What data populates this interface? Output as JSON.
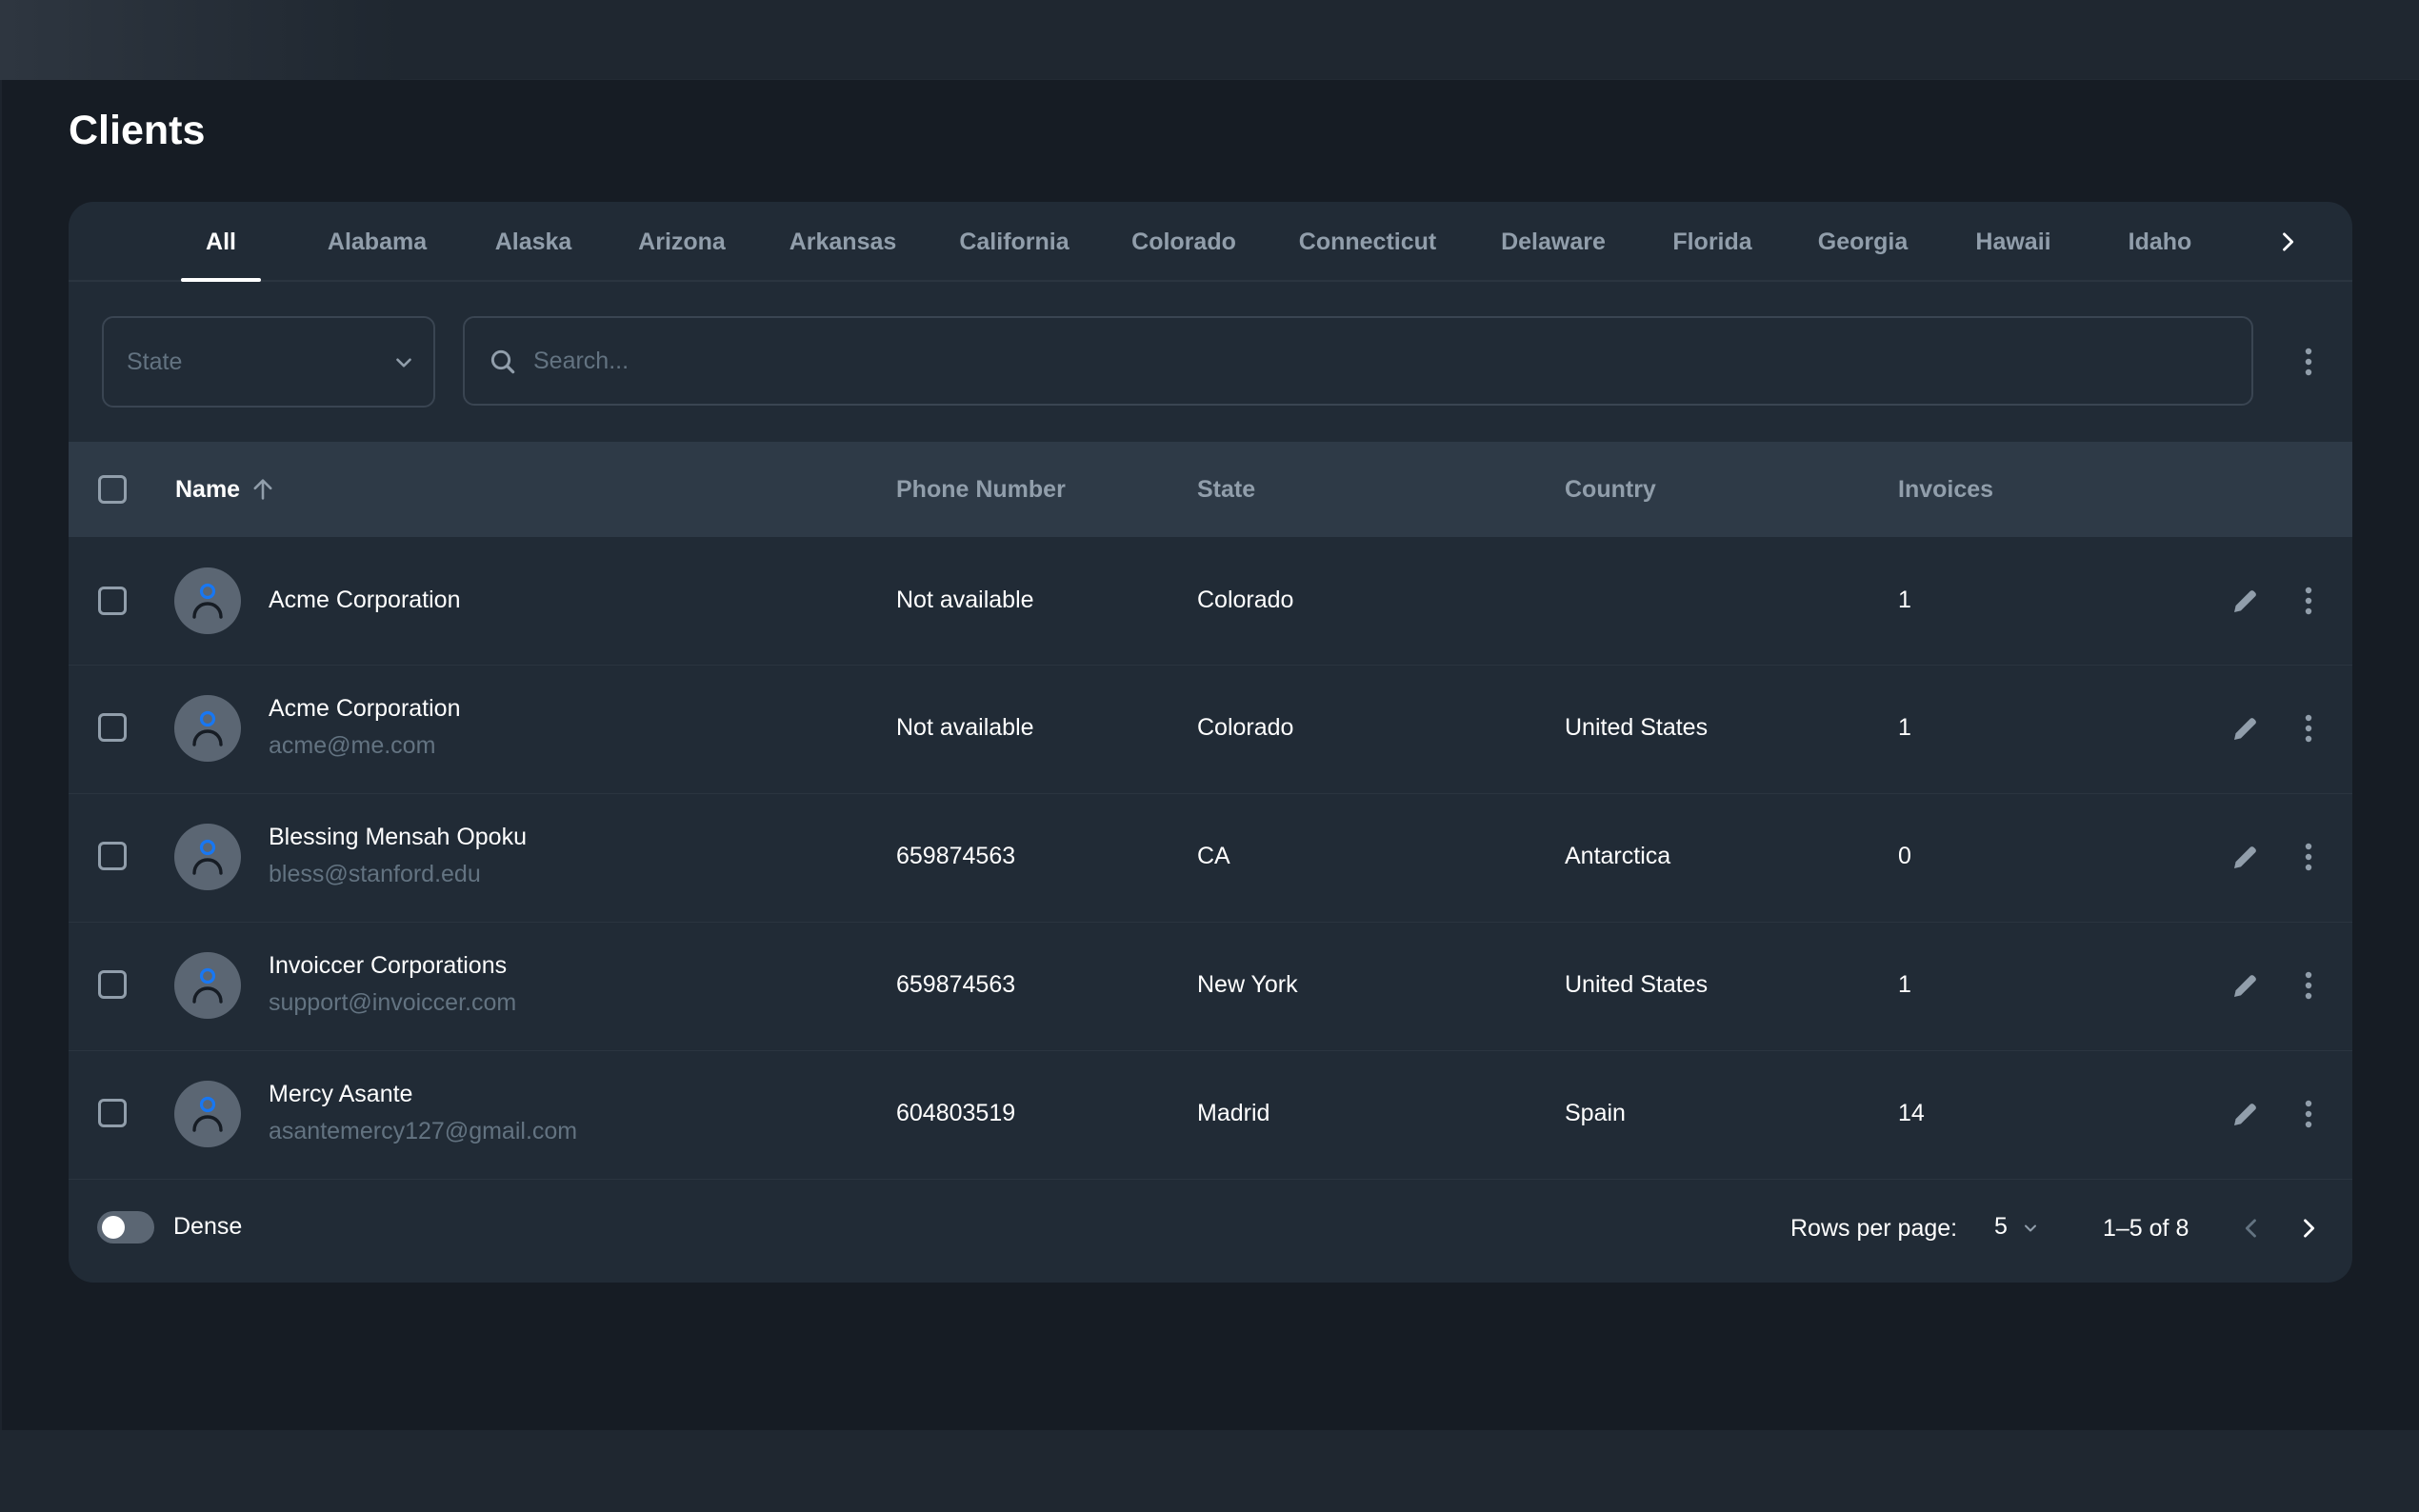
{
  "page": {
    "title": "Clients"
  },
  "tabs": [
    {
      "label": "All",
      "active": true
    },
    {
      "label": "Alabama"
    },
    {
      "label": "Alaska"
    },
    {
      "label": "Arizona"
    },
    {
      "label": "Arkansas"
    },
    {
      "label": "California"
    },
    {
      "label": "Colorado"
    },
    {
      "label": "Connecticut"
    },
    {
      "label": "Delaware"
    },
    {
      "label": "Florida"
    },
    {
      "label": "Georgia"
    },
    {
      "label": "Hawaii"
    },
    {
      "label": "Idaho"
    }
  ],
  "filters": {
    "state_placeholder": "State",
    "search_placeholder": "Search..."
  },
  "table": {
    "headers": {
      "name": "Name",
      "phone": "Phone Number",
      "state": "State",
      "country": "Country",
      "invoices": "Invoices"
    },
    "sort": {
      "column": "name",
      "direction": "ascending"
    },
    "rows": [
      {
        "name": "Acme Corporation",
        "email": "",
        "phone": "Not available",
        "state": "Colorado",
        "country": "",
        "invoices": "1"
      },
      {
        "name": "Acme Corporation",
        "email": "acme@me.com",
        "phone": "Not available",
        "state": "Colorado",
        "country": "United States",
        "invoices": "1"
      },
      {
        "name": "Blessing Mensah Opoku",
        "email": "bless@stanford.edu",
        "phone": "659874563",
        "state": "CA",
        "country": "Antarctica",
        "invoices": "0"
      },
      {
        "name": "Invoiccer Corporations",
        "email": "support@invoiccer.com",
        "phone": "659874563",
        "state": "New York",
        "country": "United States",
        "invoices": "1"
      },
      {
        "name": "Mercy Asante",
        "email": "asantemercy127@gmail.com",
        "phone": "604803519",
        "state": "Madrid",
        "country": "Spain",
        "invoices": "14"
      }
    ]
  },
  "footer": {
    "dense_label": "Dense",
    "dense_enabled": false,
    "rows_per_page_label": "Rows per page:",
    "rows_per_page_value": "5",
    "range_text": "1–5 of 8"
  },
  "icons": {
    "tab_next": "chevron-right-icon",
    "select": "chevron-down-icon",
    "search": "search-icon",
    "more": "more-vertical-icon",
    "sort": "arrow-up-icon",
    "avatar": "person-icon",
    "edit": "pencil-icon",
    "prev": "chevron-left-icon",
    "next": "chevron-right-icon"
  },
  "colors": {
    "background": "#161c24",
    "card": "#212b36",
    "table_header": "#2e3a47",
    "text_primary": "#ffffff",
    "text_secondary": "#919eab",
    "text_muted": "#637381",
    "avatar_bg": "#5b6673",
    "avatar_icon": "#1877f2"
  }
}
